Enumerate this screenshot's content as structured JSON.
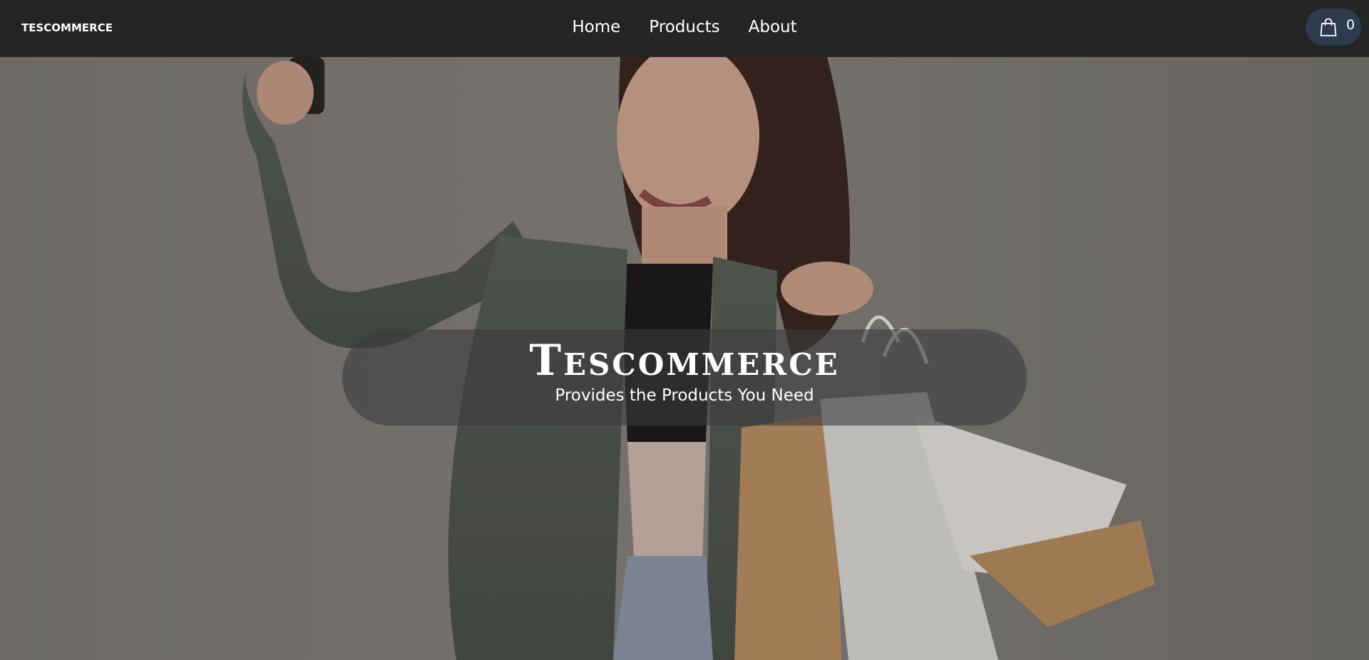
{
  "header": {
    "brand": "TESCOMMERCE",
    "nav": [
      {
        "label": "Home"
      },
      {
        "label": "Products"
      },
      {
        "label": "About"
      }
    ],
    "cart": {
      "count": "0",
      "icon": "shopping-bag-icon"
    }
  },
  "hero": {
    "title": "Tescommerce",
    "subtitle": "Provides the Products You Need",
    "image": "woman-shopping-selfie-photo"
  },
  "colors": {
    "navbar": "#242424",
    "cart_pill": "#2e3a4e",
    "banner": "rgba(60,60,60,0.6)",
    "text": "#ffffff"
  }
}
